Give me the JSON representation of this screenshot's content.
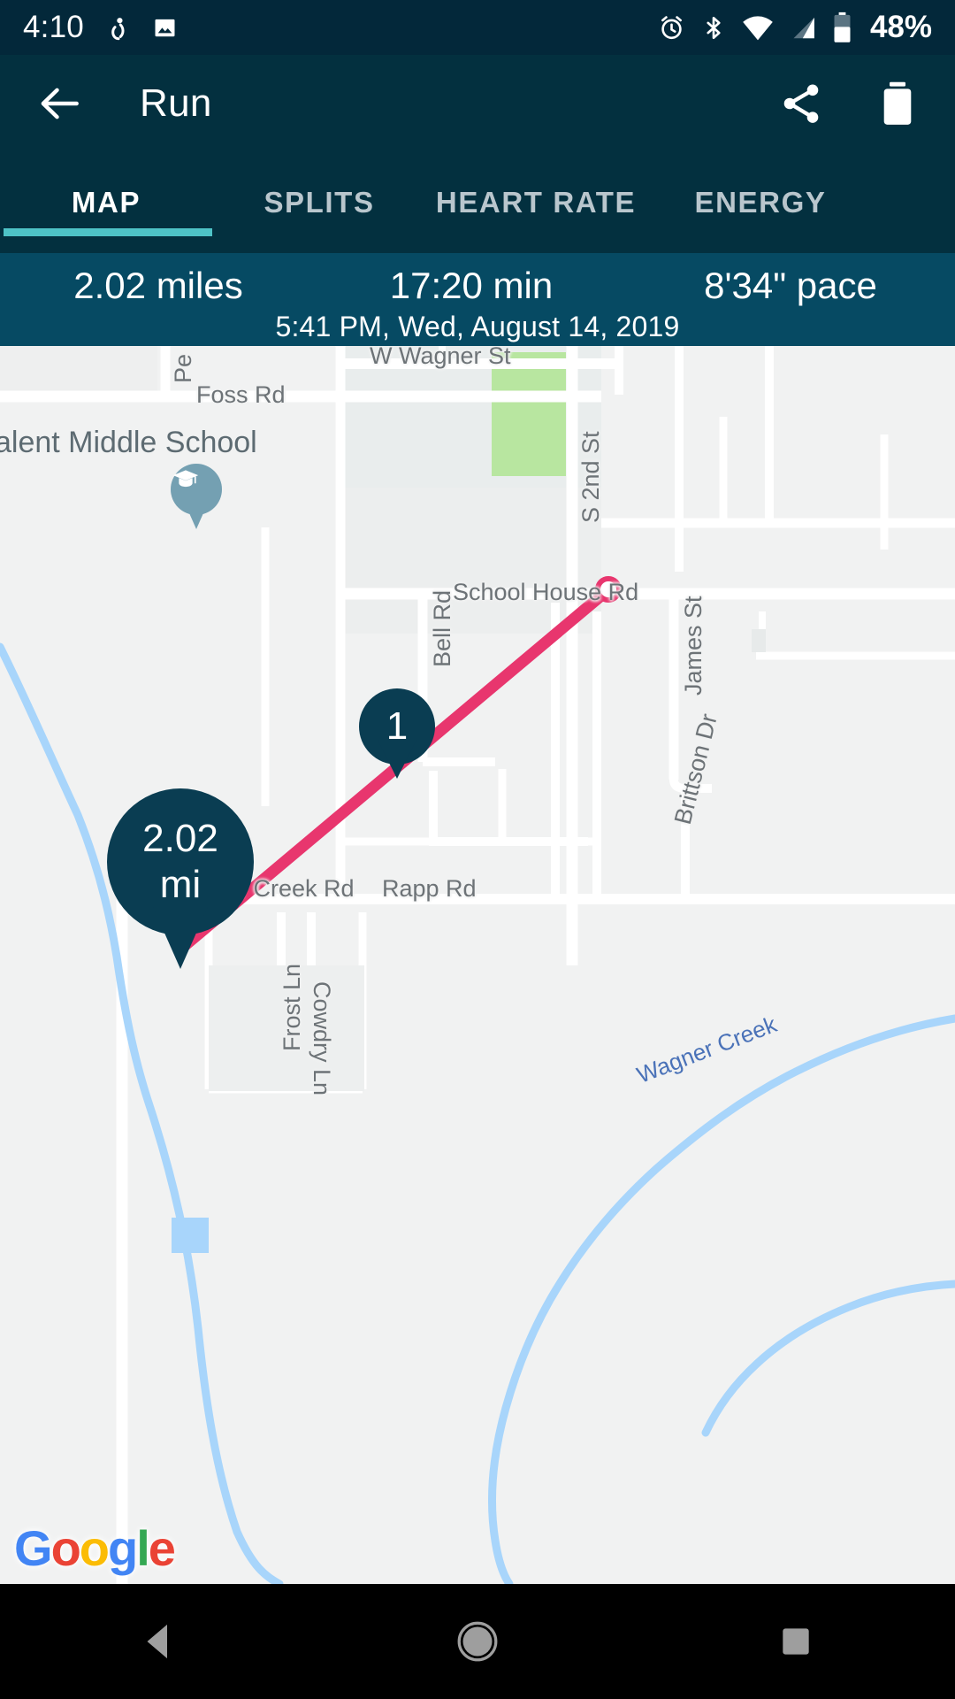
{
  "status_bar": {
    "time": "4:10",
    "battery_percent": "48%",
    "icons": [
      "screenshot-icon",
      "image-icon",
      "alarm-icon",
      "bluetooth-icon",
      "wifi-icon",
      "signal-icon",
      "battery-icon"
    ]
  },
  "app_bar": {
    "back_label": "back-arrow",
    "title": "Run",
    "share_label": "share-icon",
    "delete_label": "delete-icon"
  },
  "tabs": {
    "items": [
      {
        "label": "MAP",
        "selected": true
      },
      {
        "label": "SPLITS",
        "selected": false
      },
      {
        "label": "HEART RATE",
        "selected": false
      },
      {
        "label": "ENERGY",
        "selected": false
      }
    ],
    "indicator_color": "#4ec3c7"
  },
  "stats": {
    "distance": "2.02 miles",
    "duration": "17:20 min",
    "pace": "8'34\" pace",
    "datetime": "5:41 PM, Wed, August 14, 2019",
    "background_color": "#064a63"
  },
  "map": {
    "attribution": "Google",
    "route_color": "#e8366e",
    "marker_color": "#0a3d52",
    "start_marker": {
      "label": "2.02\nmi",
      "value": "2.02",
      "unit": "mi"
    },
    "mile_markers": [
      {
        "label": "1"
      }
    ],
    "poi": {
      "name": "alent Middle School",
      "icon": "graduation-cap-icon"
    },
    "street_labels": [
      "Pe",
      "Foss Rd",
      "W Wagner St",
      "S 2nd St",
      "School House Rd",
      "Bell Rd",
      "James St",
      "Brittson Dr",
      "er Creek Rd",
      "Rapp Rd",
      "Frost Ln",
      "Cowdry Ln",
      "Wagner Creek"
    ]
  },
  "nav_bar": {
    "back": "nav-back-triangle",
    "home": "nav-home-circle",
    "recents": "nav-recents-square"
  }
}
